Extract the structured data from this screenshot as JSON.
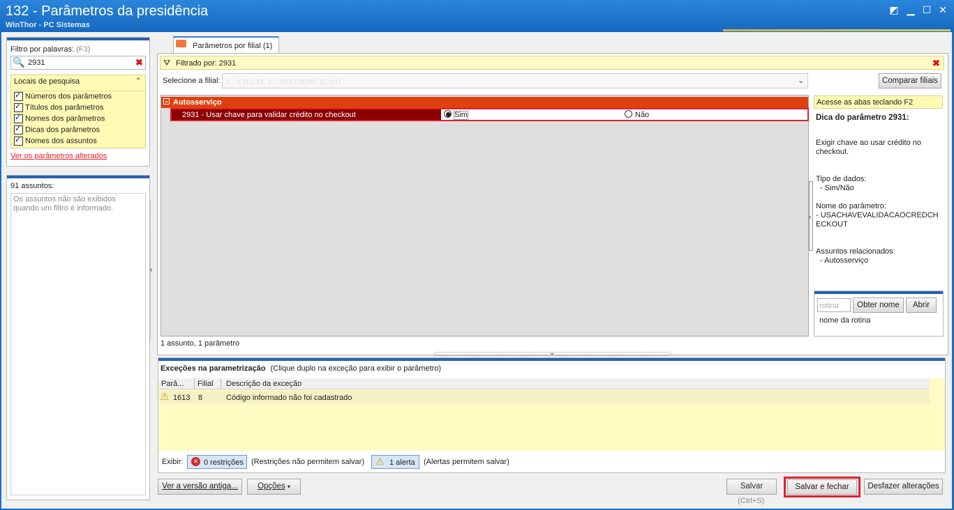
{
  "window": {
    "title": "132 - Parâmetros da presidência",
    "subtitle": "WinThor - PC Sistemas"
  },
  "filter": {
    "label": "Filtro por palavras:",
    "shortcut": "(F3)",
    "value": "2931",
    "locations_title": "Locais de pesquisa",
    "locations": [
      {
        "label": "Números dos parâmetros",
        "checked": true
      },
      {
        "label": "Títulos dos parâmetros",
        "checked": true
      },
      {
        "label": "Nomes dos parâmetros",
        "checked": true
      },
      {
        "label": "Dicas dos parâmetros",
        "checked": true
      },
      {
        "label": "Nomes dos assuntos",
        "checked": true
      }
    ],
    "changed_link": "Ver os parâmetros alterados"
  },
  "subjects": {
    "count_label": "91 assuntos:",
    "empty_text": "Os assuntos não são exibidos quando um filtro é informado."
  },
  "tab": {
    "label": "Parâmetros por filial  (1)"
  },
  "filtered_by": "Filtrado por: 2931",
  "branch": {
    "label": "Selecione a filial:",
    "value": "1 - FILIAL 1 - DISTRIBUIÇÃO",
    "compare_button": "Comparar filiais"
  },
  "grid": {
    "group": "Autosserviço",
    "param_label": "2931 - Usar chave para validar crédito no checkout",
    "option_yes": "Sim",
    "option_no": "Não",
    "selected": "Sim",
    "footer": "1 assunto, 1 parâmetro"
  },
  "hint": {
    "tabs_tip": "Acesse as abas teclando F2",
    "title": "Dica do parâmetro 2931:",
    "description": "Exigir chave ao usar crédito no checkout.",
    "type_label": "Tipo de dados:",
    "type_value": "- Sim/Não",
    "name_label": "Nome do parâmetro:",
    "name_value": "- USACHAVEVALIDACAOCREDCHECKOUT",
    "related_label": "Assuntos relacionados:",
    "related_value": "- Autosserviço"
  },
  "routine": {
    "placeholder": "rotina",
    "get_name_button": "Obter nome",
    "open_button": "Abrir",
    "name_label": "nome da rotina"
  },
  "exceptions": {
    "title": "Exceções na parametrização",
    "subtitle": "(Clique duplo na exceção para exibir o parâmetro)",
    "columns": [
      "Parâ...",
      "Filial",
      "Descrição da exceção"
    ],
    "rows": [
      {
        "param": "1613",
        "branch": "8",
        "description": "Código informado não foi cadastrado"
      }
    ],
    "show_label": "Exibir:",
    "restrictions_button": "0 restrições",
    "restrictions_note": "(Restrições não permitem salvar)",
    "alerts_button": "1 alerta",
    "alerts_note": "(Alertas permitem salvar)"
  },
  "bottom": {
    "old_version_button": "Ver a versão antiga...",
    "options_button": "Opções",
    "save_button": "Salvar",
    "save_shortcut": "(Ctrl+S)",
    "save_close_button": "Salvar e fechar",
    "undo_button": "Desfazer alterações"
  },
  "colors": {
    "title_bar": "#1a6fc4",
    "group_header": "#e0400f",
    "selected_row": "#8b0000",
    "highlight_border": "#e0202a"
  }
}
